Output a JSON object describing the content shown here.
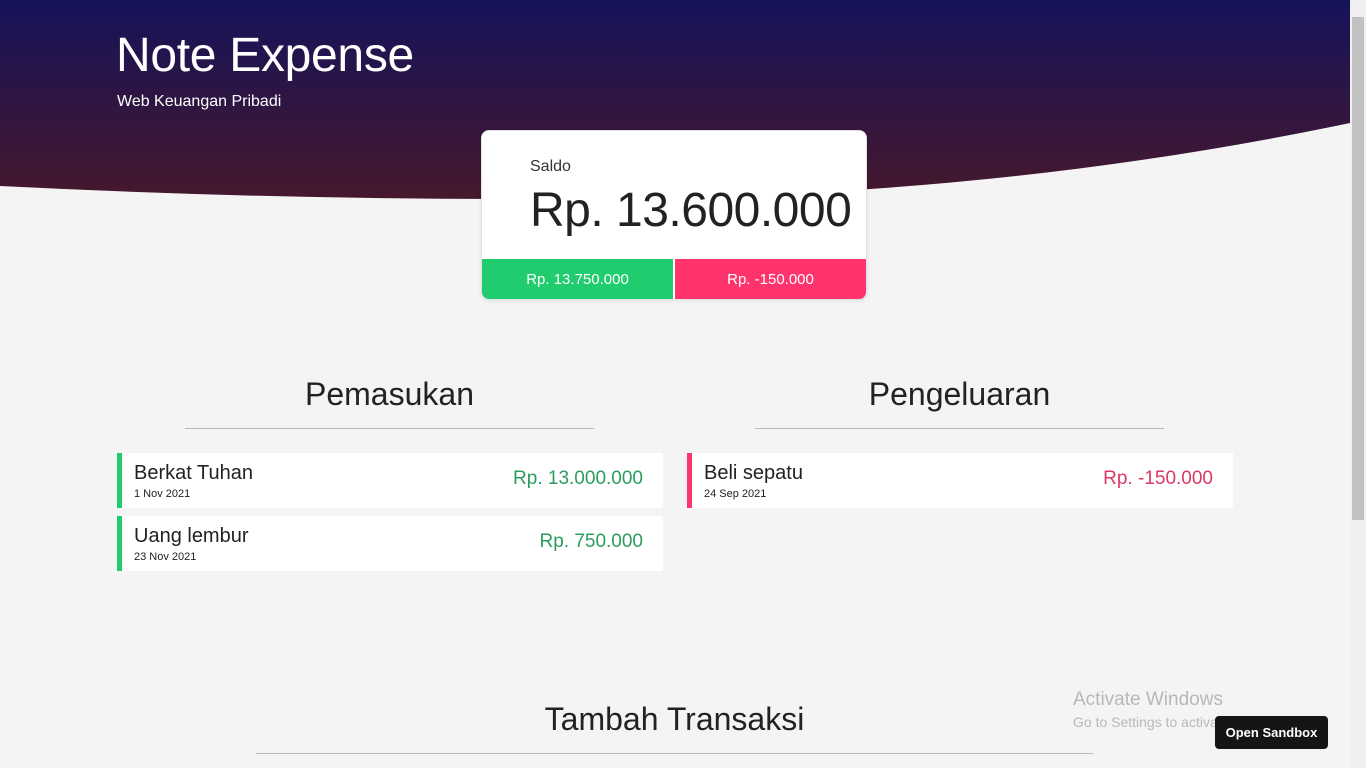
{
  "header": {
    "title": "Note Expense",
    "subtitle": "Web Keuangan Pribadi",
    "gradient_top": "#16135a",
    "gradient_bottom": "#46182c"
  },
  "balance": {
    "label": "Saldo",
    "amount": "Rp. 13.600.000",
    "total_income": "Rp. 13.750.000",
    "total_expense": "Rp. -150.000",
    "income_color": "#21cc6f",
    "expense_color": "#ff346c"
  },
  "income": {
    "heading": "Pemasukan",
    "items": [
      {
        "name": "Berkat Tuhan",
        "date": "1 Nov 2021",
        "amount": "Rp. 13.000.000"
      },
      {
        "name": "Uang lembur",
        "date": "23 Nov 2021",
        "amount": "Rp. 750.000"
      }
    ]
  },
  "expense": {
    "heading": "Pengeluaran",
    "items": [
      {
        "name": "Beli sepatu",
        "date": "24 Sep 2021",
        "amount": "Rp. -150.000"
      }
    ]
  },
  "add_transaction": {
    "heading": "Tambah Transaksi"
  },
  "overlay": {
    "activate_title": "Activate Windows",
    "activate_sub": "Go to Settings to activate Windows.",
    "sandbox_button": "Open Sandbox"
  }
}
